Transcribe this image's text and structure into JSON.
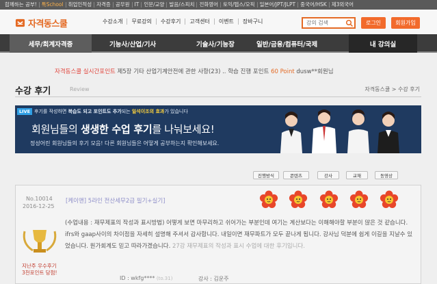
{
  "topbar": {
    "items": [
      "합께하는 공부!",
      "톡School",
      "취업인적성",
      "자격증",
      "공무원",
      "IT",
      "인문/교양",
      "발음/스피치",
      "전화영어",
      "토익/텝스/오픽",
      "일본어/JPT/JLPT",
      "중국어/HSK",
      "제3외국어"
    ]
  },
  "header": {
    "logo_text": "자격동스쿨",
    "menu": [
      "수강소개",
      "무료강의",
      "수강후기",
      "고객센터",
      "이벤트",
      "장바구니"
    ],
    "search_placeholder": "강의 검색",
    "login_label": "로그인",
    "join_label": "회원가입"
  },
  "nav": {
    "items": [
      "세무/회계자격증",
      "기능사/산업/기사",
      "기술사/기능장",
      "일반/금융/컴퓨터/국제",
      "내 강의실"
    ]
  },
  "ticker": {
    "part1": "자격동스쿨 실시간포인트",
    "part2": "제5장 기타 산업기계안전에 관한 사항(23) .. 학습 진행 포인트",
    "points": "60 Point",
    "part3": "dusw**회원님"
  },
  "page": {
    "title": "수강 후기",
    "subtitle": "Review",
    "breadcrumb": "자격동스쿨 > 수강 후기"
  },
  "banner": {
    "live": "LIVE",
    "top_text_1": "후기를 작성하면",
    "top_text_2": "복습도 되고 포인트도 추가",
    "top_text_3": "되는",
    "top_text_4": "일석이조의 효과",
    "top_text_5": "가 있습니다",
    "headline_1": "회원님들의 ",
    "headline_2": "생생한 수업 후기",
    "headline_3": "를 나눠보세요!",
    "sub": "정성어린 회원님들의 후기 모음! 다른 회원님들은 어떻게 공부하는지 확인해보세요."
  },
  "tabs": [
    "진행방식",
    "콘텐츠",
    "강사",
    "교재",
    "동영상"
  ],
  "review": {
    "no": "No.10014",
    "date": "2016-12-25",
    "title": "[케이앤] 5라인 전산세무2급 필기+실기]",
    "body_main": "(수업내용 : 재무제표의 작성과 표시방법) 어떻게 보면 마무리하고 쉬어가는 부분인데 여기는 계산보다는 이해해야할 부분이 많은 것 같습니다. ifrs와 gaap사이의 차이점을 자세히 설명해 주셔서 감사합니다. 내일이면 재무파트가 모두 끝나게 됩니다. 강사님 덕분에 쉽게 이길을 지날수 있었습니다. 원가회계도 믿고 따라가겠습니다.",
    "body_faded": "27강 재무제표의 작성과 표시 수업에 대한 후기입니다.",
    "award_1": "지난주 우수후기",
    "award_2": "3천포인트 당첨!",
    "id_label": "ID : wkfg****",
    "ip": "(to.31)",
    "lecturer": "강사 : 김운주"
  },
  "colors": {
    "accent": "#f26b2c",
    "nav_bg": "#3c3c3c",
    "banner_bg": "#1f3a60",
    "award_red": "#c0392b"
  }
}
